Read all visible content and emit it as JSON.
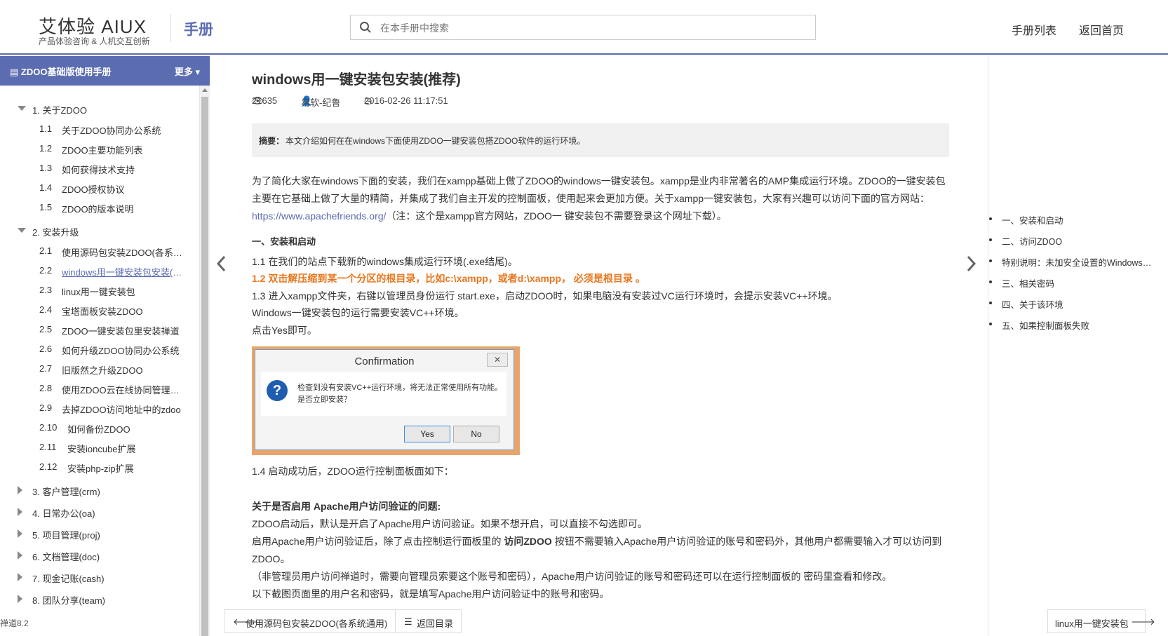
{
  "header": {
    "logo_title": "艾体验 AIUX",
    "logo_sub": "产品体验咨询 & 人机交互创新",
    "brand_link": "手册",
    "search_placeholder": "在本手册中搜索",
    "nav": [
      "手册列表",
      "返回首页"
    ]
  },
  "sidebar": {
    "title": "ZDOO基础版使用手册",
    "more": "更多",
    "chapters": [
      {
        "label": "1.  关于ZDOO",
        "expanded": true,
        "items": [
          {
            "num": "1.1",
            "label": "关于ZDOO协同办公系统"
          },
          {
            "num": "1.2",
            "label": "ZDOO主要功能列表"
          },
          {
            "num": "1.3",
            "label": "如何获得技术支持"
          },
          {
            "num": "1.4",
            "label": "ZDOO授权协议"
          },
          {
            "num": "1.5",
            "label": "ZDOO的版本说明"
          }
        ]
      },
      {
        "label": "2.  安装升级",
        "expanded": true,
        "items": [
          {
            "num": "2.1",
            "label": "使用源码包安装ZDOO(各系统通用)"
          },
          {
            "num": "2.2",
            "label": "windows用一键安装包安装(推荐)"
          },
          {
            "num": "2.3",
            "label": "linux用一键安装包"
          },
          {
            "num": "2.4",
            "label": "宝塔面板安装ZDOO"
          },
          {
            "num": "2.5",
            "label": "ZDOO一键安装包里安装禅道"
          },
          {
            "num": "2.6",
            "label": "如何升级ZDOO协同办公系统"
          },
          {
            "num": "2.7",
            "label": "旧版然之升级ZDOO"
          },
          {
            "num": "2.8",
            "label": "使用ZDOO云在线协同管理平台"
          },
          {
            "num": "2.9",
            "label": "去掉ZDOO访问地址中的zdoo"
          },
          {
            "num": "2.10",
            "label": "如何备份ZDOO"
          },
          {
            "num": "2.11",
            "label": "安装ioncube扩展"
          },
          {
            "num": "2.12",
            "label": "安装php-zip扩展"
          }
        ]
      },
      {
        "label": "3.  客户管理(crm)",
        "expanded": false,
        "items": []
      },
      {
        "label": "4.  日常办公(oa)",
        "expanded": false,
        "items": []
      },
      {
        "label": "5.  项目管理(proj)",
        "expanded": false,
        "items": []
      },
      {
        "label": "6.  文档管理(doc)",
        "expanded": false,
        "items": []
      },
      {
        "label": "7.  现金记账(cash)",
        "expanded": false,
        "items": []
      },
      {
        "label": "8.  团队分享(team)",
        "expanded": false,
        "items": []
      }
    ],
    "version": "禅道8.2"
  },
  "article": {
    "title": "windows用一键安装包安装(推荐)",
    "views": "21635",
    "author": "易软-纪鲁",
    "date": "2016-02-26 11:17:51",
    "summary_label": "摘要：",
    "summary_text": "本文介绍如何在在windows下面使用ZDOO一键安装包搭ZDOO软件的运行环境。",
    "intro_1": "为了简化大家在windows下面的安装，我们在xampp基础上做了ZDOO的windows一键安装包。xampp是业内非常著名的AMP集成运行环境。ZDOO的一键安装包",
    "intro_2": "主要在它基础上做了大量的精简，并集成了我们自主开发的控制面板，使用起来会更加方便。关于xampp一键安装包，大家有兴趣可以访问下面的官方网站：",
    "intro_link": "https://www.apachefriends.org/",
    "intro_3": "（注：这个是xampp官方网站，ZDOO一 键安装包不需要登录这个网址下载）。",
    "section_1": "一、安装和启动",
    "step_1_1": "1.1 在我们的站点下载新的windows集成运行环境(.exe结尾)。",
    "step_1_2": "1.2   双击解压缩到某一个分区的根目录，比如c:\\xampp，或者d:\\xampp，  必须是根目录 。",
    "step_1_3": "1.3 进入xampp文件夹，右键以管理员身份运行 start.exe，启动ZDOO时，如果电脑没有安装过VC运行环境时，会提示安装VC++环境。",
    "step_1_3b": "Windows一键安装包的运行需要安装VC++环境。",
    "step_1_3c": "点击Yes即可。",
    "dialog": {
      "title": "Confirmation",
      "close": "✕",
      "message": "检查到没有安装VC++运行环境，将无法正常使用所有功能。是否立即安装？",
      "yes": "Yes",
      "no": "No"
    },
    "step_1_4": "1.4 启动成功后，ZDOO运行控制面板面如下：",
    "apache_heading": "关于是否启用 Apache用户访问验证的问题:",
    "apache_1": "ZDOO启动后，默认是开启了Apache用户访问验证。如果不想开启，可以直接不勾选即可。",
    "apache_2a": "启用Apache用户访问验证后，除了点击控制运行面板里的 ",
    "apache_2b": "访问ZDOO",
    "apache_2c": " 按钮不需要输入Apache用户访问验证的账号和密码外，其他用户都需要输入才可以访问到",
    "apache_3": "ZDOO。",
    "apache_4": "（非管理员用户访问禅道时，需要向管理员索要这个账号和密码），Apache用户访问验证的账号和密码还可以在运行控制面板的 密码里查看和修改。",
    "apache_5": "以下截图页面里的用户名和密码，就是填写Apache用户访问验证中的账号和密码。"
  },
  "toc": [
    "一、安装和启动",
    "二、访问ZDOO",
    "特别说明：未加安全设置的Windows一键安装包",
    "三、相关密码",
    "四、关于该环境",
    "五、如果控制面板失败"
  ],
  "bottom_nav": {
    "prev": "使用源码包安装ZDOO(各系统通用)",
    "catalog": "返回目录",
    "next": "linux用一键安装包"
  }
}
